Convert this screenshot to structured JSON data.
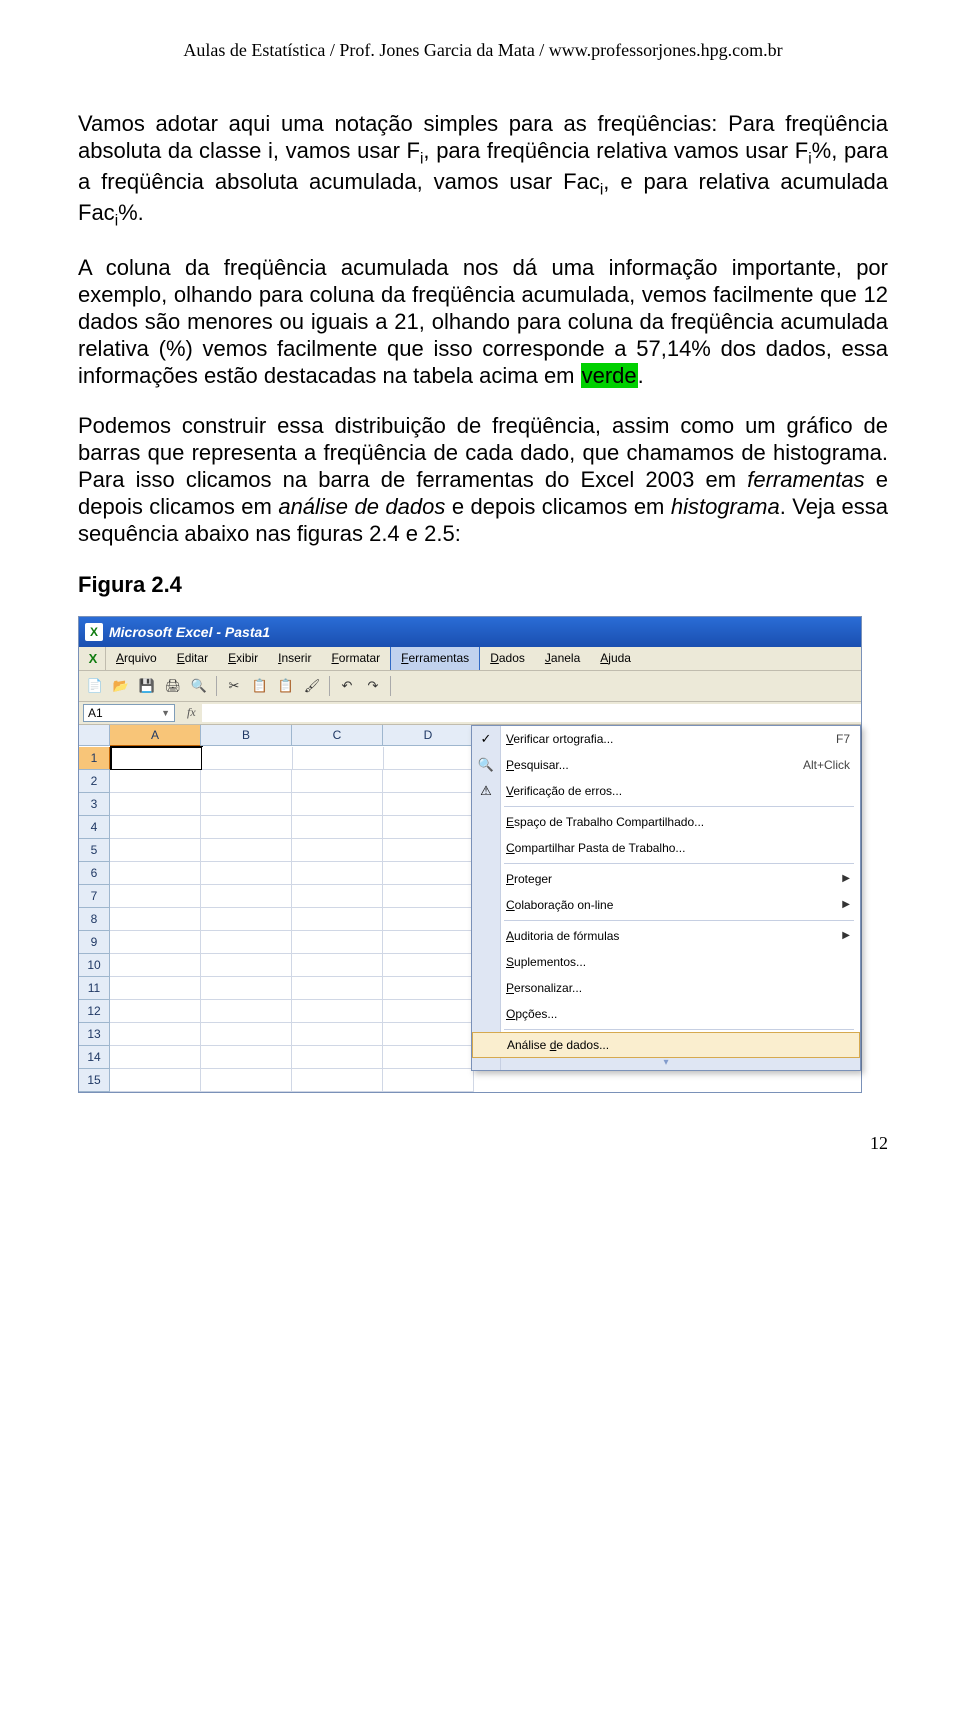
{
  "header": "Aulas de Estatística / Prof. Jones Garcia da Mata / www.professorjones.hpg.com.br",
  "para1a": "Vamos adotar aqui uma notação simples para as freqüências: Para freqüência absoluta da classe i, vamos usar F",
  "para1b": ", para freqüência relativa vamos usar F",
  "para1c": "%, para a freqüência absoluta acumulada, vamos usar Fac",
  "para1d": ", e para relativa acumulada Fac",
  "para1e": "%.",
  "sub_i": "i",
  "para2a": "A coluna da freqüência acumulada nos dá uma informação importante, por exemplo, olhando para coluna da freqüência acumulada, vemos facilmente que 12 dados são menores ou iguais a 21, olhando para coluna da freqüência acumulada relativa (%) vemos facilmente que isso corresponde a 57,14% dos dados, essa informações estão destacadas na tabela acima em ",
  "para2_hl": "verde",
  "para2b": ".",
  "para3a": "Podemos construir essa distribuição de freqüência, assim como um gráfico de barras que representa a freqüência de cada dado, que chamamos de histograma. Para isso clicamos na barra de ferramentas do Excel 2003 em ",
  "para3_i1": "ferramentas",
  "para3b": " e depois clicamos em ",
  "para3_i2": "análise de dados",
  "para3c": " e depois clicamos em ",
  "para3_i3": "histograma",
  "para3d": ". Veja essa sequência abaixo nas figuras 2.4 e 2.5:",
  "figlabel": "Figura 2.4",
  "pageno": "12",
  "excel": {
    "title": "Microsoft Excel - Pasta1",
    "menus": [
      "Arquivo",
      "Editar",
      "Exibir",
      "Inserir",
      "Formatar",
      "Ferramentas",
      "Dados",
      "Janela",
      "Ajuda"
    ],
    "activeMenuIndex": 5,
    "namebox": "A1",
    "fx": "fx",
    "cols": [
      "A",
      "B",
      "C",
      "D"
    ],
    "rows": [
      "1",
      "2",
      "3",
      "4",
      "5",
      "6",
      "7",
      "8",
      "9",
      "10",
      "11",
      "12",
      "13",
      "14",
      "15"
    ],
    "dropdown": [
      {
        "type": "item",
        "icon": "✓",
        "label": "Verificar ortografia...",
        "u": "V",
        "shortcut": "F7"
      },
      {
        "type": "item",
        "icon": "🔍",
        "label": "Pesquisar...",
        "u": "P",
        "shortcut": "Alt+Click"
      },
      {
        "type": "item",
        "icon": "⚠",
        "label": "Verificação de erros...",
        "u": "V"
      },
      {
        "type": "sep"
      },
      {
        "type": "item",
        "label": "Espaço de Trabalho Compartilhado...",
        "u": "E"
      },
      {
        "type": "item",
        "label": "Compartilhar Pasta de Trabalho...",
        "u": "C"
      },
      {
        "type": "sep"
      },
      {
        "type": "item",
        "label": "Proteger",
        "u": "P",
        "arrow": true
      },
      {
        "type": "item",
        "label": "Colaboração on-line",
        "u": "C",
        "arrow": true
      },
      {
        "type": "sep"
      },
      {
        "type": "item",
        "label": "Auditoria de fórmulas",
        "u": "A",
        "arrow": true
      },
      {
        "type": "item",
        "label": "Suplementos...",
        "u": "S"
      },
      {
        "type": "item",
        "label": "Personalizar...",
        "u": "P"
      },
      {
        "type": "item",
        "label": "Opções...",
        "u": "O"
      },
      {
        "type": "sep"
      },
      {
        "type": "item",
        "label": "Análise de dados...",
        "u": "d",
        "hover": true
      }
    ],
    "toolbar": [
      "📄",
      "📂",
      "💾",
      "🖨",
      "🔍",
      "|",
      "✂",
      "📋",
      "📋",
      "🖌",
      "|",
      "↶",
      "↷",
      "|"
    ]
  }
}
